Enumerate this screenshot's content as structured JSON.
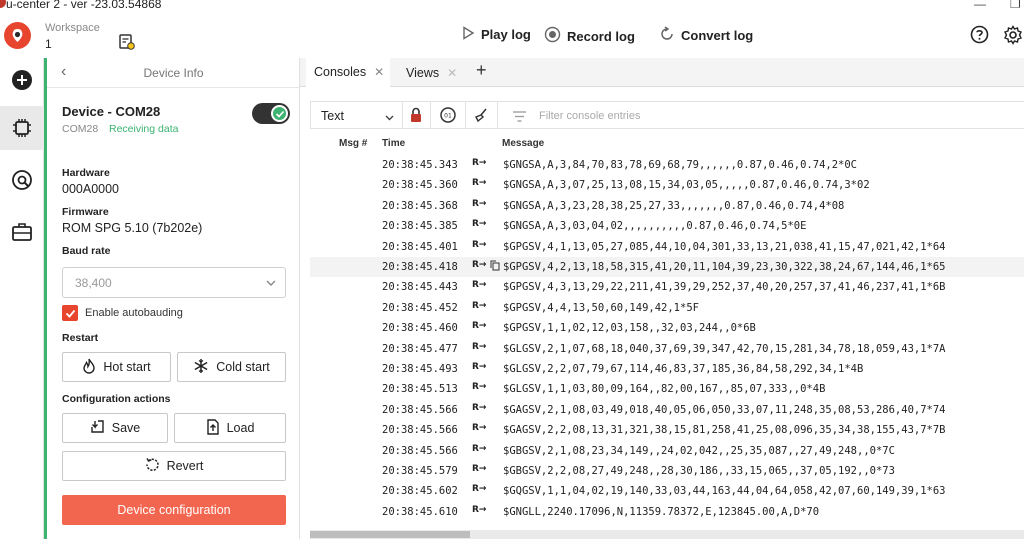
{
  "window": {
    "title": "u-center 2 - ver -23.03.54868"
  },
  "workspace": {
    "label": "Workspace",
    "value": "1"
  },
  "toolbar": {
    "play_label": "Play log",
    "record_label": "Record log",
    "convert_label": "Convert log"
  },
  "panel": {
    "title": "Device Info",
    "device_name": "Device - COM28",
    "device_port": "COM28",
    "device_status": "Receiving data",
    "hardware_label": "Hardware",
    "hardware_value": "000A0000",
    "firmware_label": "Firmware",
    "firmware_value": "ROM SPG 5.10 (7b202e)",
    "baud_label": "Baud rate",
    "baud_value": "38,400",
    "autobaud_label": "Enable autobauding",
    "restart_label": "Restart",
    "hot_start": "Hot start",
    "cold_start": "Cold start",
    "config_label": "Configuration actions",
    "save": "Save",
    "load": "Load",
    "revert": "Revert",
    "device_config": "Device configuration"
  },
  "tabs": [
    {
      "label": "Consoles"
    },
    {
      "label": "Views"
    }
  ],
  "console": {
    "view_mode": "Text",
    "filter_placeholder": "Filter console entries",
    "columns": {
      "msg": "Msg #",
      "time": "Time",
      "message": "Message"
    },
    "direction": "R→",
    "rows": [
      {
        "time": "20:38:45.343",
        "message": "$GNGSA,A,3,84,70,83,78,69,68,79,,,,,,0.87,0.46,0.74,2*0C"
      },
      {
        "time": "20:38:45.360",
        "message": "$GNGSA,A,3,07,25,13,08,15,34,03,05,,,,,0.87,0.46,0.74,3*02"
      },
      {
        "time": "20:38:45.368",
        "message": "$GNGSA,A,3,23,28,38,25,27,33,,,,,,,0.87,0.46,0.74,4*08"
      },
      {
        "time": "20:38:45.385",
        "message": "$GNGSA,A,3,03,04,02,,,,,,,,,,0.87,0.46,0.74,5*0E"
      },
      {
        "time": "20:38:45.401",
        "message": "$GPGSV,4,1,13,05,27,085,44,10,04,301,33,13,21,038,41,15,47,021,42,1*64"
      },
      {
        "time": "20:38:45.418",
        "message": "$GPGSV,4,2,13,18,58,315,41,20,11,104,39,23,30,322,38,24,67,144,46,1*65"
      },
      {
        "time": "20:38:45.443",
        "message": "$GPGSV,4,3,13,29,22,211,41,39,29,252,37,40,20,257,37,41,46,237,41,1*6B"
      },
      {
        "time": "20:38:45.452",
        "message": "$GPGSV,4,4,13,50,60,149,42,1*5F"
      },
      {
        "time": "20:38:45.460",
        "message": "$GPGSV,1,1,02,12,03,158,,32,03,244,,0*6B"
      },
      {
        "time": "20:38:45.477",
        "message": "$GLGSV,2,1,07,68,18,040,37,69,39,347,42,70,15,281,34,78,18,059,43,1*7A"
      },
      {
        "time": "20:38:45.493",
        "message": "$GLGSV,2,2,07,79,67,114,46,83,37,185,36,84,58,292,34,1*4B"
      },
      {
        "time": "20:38:45.513",
        "message": "$GLGSV,1,1,03,80,09,164,,82,00,167,,85,07,333,,0*4B"
      },
      {
        "time": "20:38:45.566",
        "message": "$GAGSV,2,1,08,03,49,018,40,05,06,050,33,07,11,248,35,08,53,286,40,7*74"
      },
      {
        "time": "20:38:45.566",
        "message": "$GAGSV,2,2,08,13,31,321,38,15,81,258,41,25,08,096,35,34,38,155,43,7*7B"
      },
      {
        "time": "20:38:45.566",
        "message": "$GBGSV,2,1,08,23,34,149,,24,02,042,,25,35,087,,27,49,248,,0*7C"
      },
      {
        "time": "20:38:45.579",
        "message": "$GBGSV,2,2,08,27,49,248,,28,30,186,,33,15,065,,37,05,192,,0*73"
      },
      {
        "time": "20:38:45.602",
        "message": "$GQGSV,1,1,04,02,19,140,33,03,44,163,44,04,64,058,42,07,60,149,39,1*63"
      },
      {
        "time": "20:38:45.610",
        "message": "$GNGLL,2240.17096,N,11359.78372,E,123845.00,A,D*70"
      }
    ]
  },
  "colors": {
    "accent": "#f2654f",
    "status_green": "#3cb371",
    "brand": "#e8452f"
  }
}
